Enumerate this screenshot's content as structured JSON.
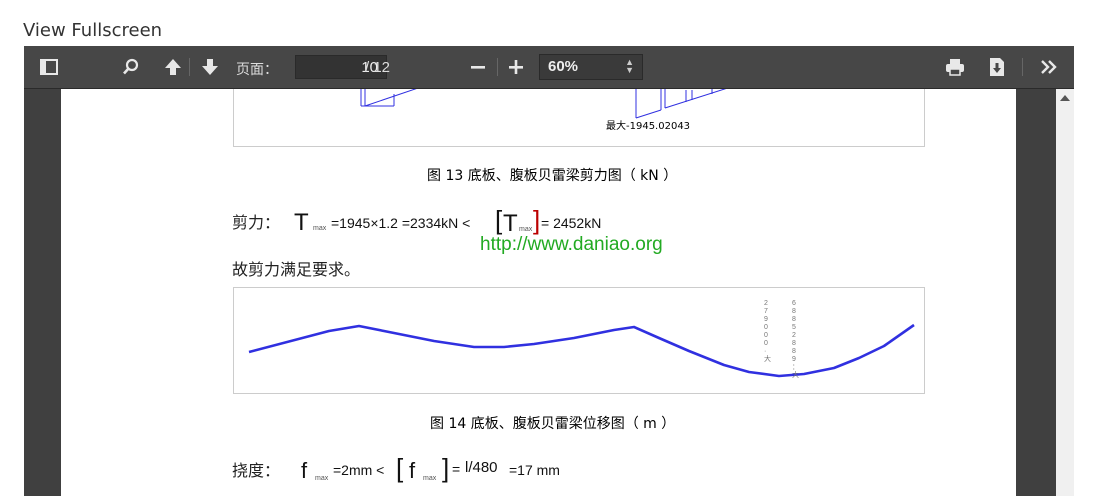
{
  "header": {
    "view_fullscreen": "View Fullscreen"
  },
  "toolbar": {
    "page_label": "页面：",
    "page_value": "10",
    "page_total": "/ 12",
    "zoom_value": "60%"
  },
  "figure13": {
    "max_label": "最大-1945.02043",
    "caption": "图 13 底板、腹板贝雷梁剪力图（      kN ）"
  },
  "shear": {
    "label": "剪力：",
    "T": "T",
    "max_sub": "max",
    "expr": "=1945×1.2 =2334kN  <",
    "bracket_open": "[",
    "bracket_close": "]",
    "result": "= 2452kN",
    "conclusion": "故剪力满足要求。"
  },
  "watermark": "http://www.daniao.org",
  "figure14": {
    "caption": "图 14 底板、腹板贝雷梁位移图（      m ）",
    "vlabel1": "2 7 9 0 0 0 ·   大",
    "vlabel2": "6 8 8 5 2 8 8 9 ： 大"
  },
  "deflection": {
    "label": "挠度：",
    "f": "f",
    "max_sub": "max",
    "expr": "=2mm <",
    "bracket_open": "[",
    "bracket_close": "]",
    "eq2": "=",
    "frac": "l/480",
    "result": "=17 mm"
  },
  "colors": {
    "toolbar_bg": "#474747",
    "viewer_bg": "#404040",
    "curve": "#3030e0",
    "watermark": "#22aa22"
  }
}
